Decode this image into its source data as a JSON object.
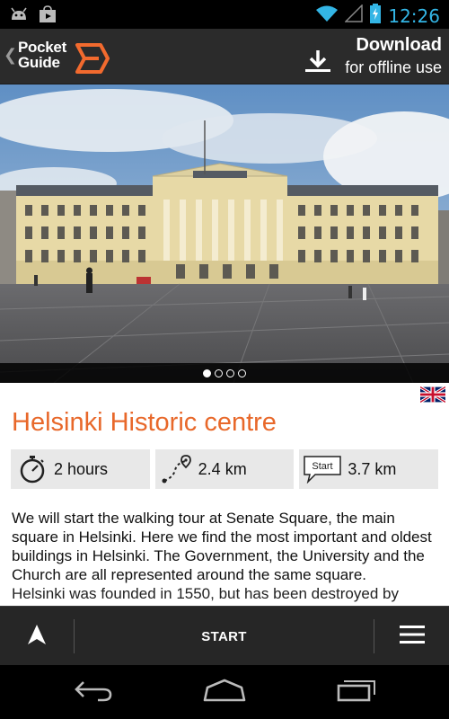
{
  "status_bar": {
    "time": "12:26",
    "icons": [
      "android-notification-icon",
      "store-notification-icon",
      "wifi-icon",
      "signal-icon",
      "battery-charging-icon"
    ]
  },
  "action_bar": {
    "logo_line1": "Pocket",
    "logo_line2": "Guide",
    "download_title": "Download",
    "download_subtitle": "for offline use",
    "accent_color": "#f26a2e"
  },
  "gallery": {
    "image": "senate-square-government-palace-photo",
    "page_count": 4,
    "current_page": 1
  },
  "tour": {
    "language": "uk-flag-icon",
    "title": "Helsinki Historic centre",
    "title_color": "#e8682a",
    "stats": [
      {
        "icon": "stopwatch-icon",
        "value": "2 hours"
      },
      {
        "icon": "route-icon",
        "value": "2.4 km"
      },
      {
        "icon": "start-bubble-icon",
        "icon_label": "Start",
        "value": "3.7 km"
      }
    ],
    "description_p1": "We will start the walking tour at Senate Square, the main square in Helsinki.  Here we find the most important and oldest buildings in Helsinki. The Government, the University and the Church are all represented around the same square.",
    "description_p2": "Helsinki was founded in 1550, but has been destroyed by"
  },
  "toolbar": {
    "start_label": "START"
  }
}
